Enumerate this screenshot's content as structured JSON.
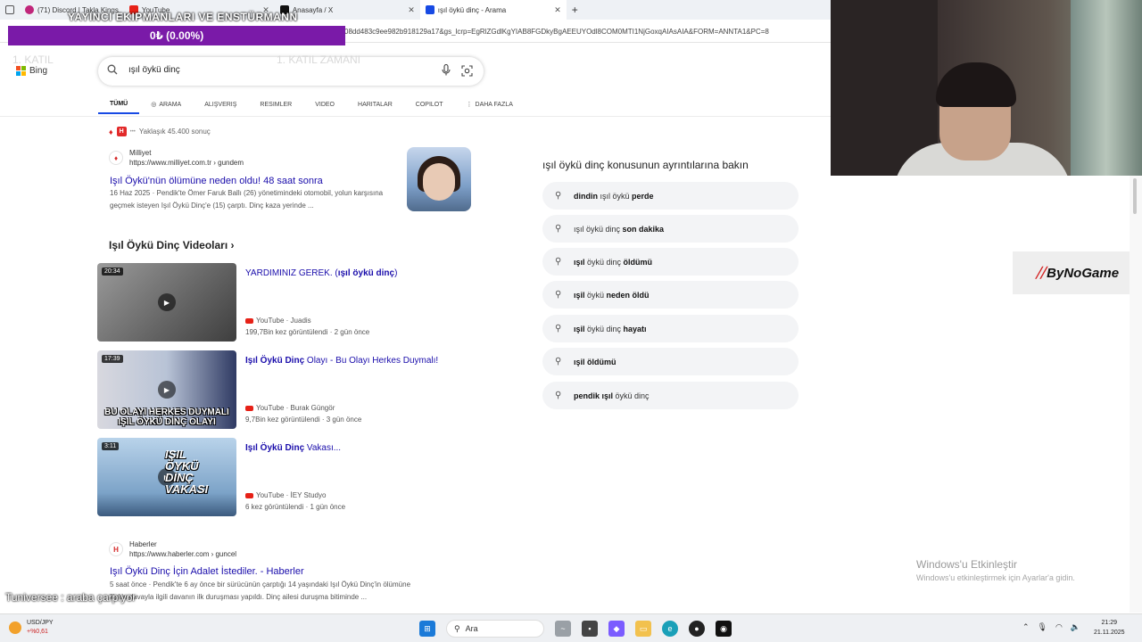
{
  "browser": {
    "tabs": [
      {
        "label": "(71) Discord | Takla Kings",
        "icon": "discord-icon",
        "color": "#5865f2"
      },
      {
        "label": "YouTube",
        "icon": "youtube-icon",
        "color": "#e62117"
      },
      {
        "label": "Anasayfa / X",
        "icon": "x-icon",
        "color": "#111111"
      },
      {
        "label": "ışıl öykü dinç - Arama",
        "icon": "bing-icon",
        "color": "#174ae4"
      }
    ],
    "new_tab": "+",
    "url": "08dd483c9ee982b918129a17&gs_lcrp=EgRlZGdlKgYIAB8FGDkyBgAEEUYOdl8COM0MTI1NjGoxqAIAsAIA&FORM=ANNTA1&PC=8"
  },
  "overlay": {
    "title": "YAYINCI EKIPMANLARI VE ENSTÜRMANN",
    "donation": "0₺ (0.00%)",
    "faint_left": "1. KATIL",
    "faint_mid": "1. KATIL ZAMANI",
    "sponsor": "ByNoGame",
    "ticker": "Tuniversee : araba çarpıyor",
    "activate_title": "Windows'u Etkinleştir",
    "activate_sub": "Windows'u etkinleştirmek için Ayarlar'a gidin."
  },
  "bing": {
    "logo": "Bing",
    "query": "ışıl öykü dinç",
    "tabs": [
      "TÜMÜ",
      "ARAMA",
      "ALIŞVERIŞ",
      "RESIMLER",
      "VIDEO",
      "HARITALAR",
      "COPILOT",
      "DAHA FAZLA"
    ]
  },
  "results": {
    "count": "Yaklaşık 45.400 sonuç",
    "first": {
      "site": "Milliyet",
      "url": "https://www.milliyet.com.tr › gundem",
      "title": "Işıl Öykü'nün ölümüne neden oldu! 48 saat sonra",
      "snippet": "16 Haz 2025 · Pendik'te Ömer Faruk Ballı (26) yönetimindeki otomobil, yolun karşısına geçmek isteyen Işıl Öykü Dinç'e (15) çarptı. Dinç kaza yerinde ..."
    },
    "videos_heading": "Işıl Öykü Dinç Videoları",
    "videos": [
      {
        "duration": "20:34",
        "title_pre": "YARDIMINIZ GEREK. (",
        "title_bold": "ışıl öykü dinç",
        "title_post": ")",
        "channel": "YouTube · Juadis",
        "meta": "199,7Bin kez görüntülendi · 2 gün önce"
      },
      {
        "duration": "17:39",
        "title_pre": "",
        "title_bold": "Işıl Öykü Dinç",
        "title_post": " Olayı - Bu Olayı Herkes Duymalı!",
        "channel": "YouTube · Burak Güngör",
        "meta": "9,7Bin kez görüntülendi · 3 gün önce",
        "caption": "BU OLAYI HERKES DUYMALI IŞIL ÖYKÜ DİNÇ OLAYI"
      },
      {
        "duration": "3:11",
        "title_pre": "",
        "title_bold": "Işıl Öykü Dinç",
        "title_post": " Vakası...",
        "channel": "YouTube · İEY Studyo",
        "meta": "6 kez görüntülendi · 1 gün önce",
        "caption": "IŞIL ÖYKÜ DİNÇ VAKASI"
      }
    ],
    "second": {
      "site": "Haberler",
      "url": "https://www.haberler.com › guncel",
      "title": "Işıl Öykü Dinç İçin Adalet İstediler. - Haberler",
      "snippet_line1": "5 saat önce · Pendik'te 6 ay önce bir sürücünün çarptığı 14 yaşındaki Işıl Öykü Dinç'in ölümüne",
      "snippet_line2": "ilişkin davayla ilgili davanın ilk duruşması yapıldı. Dinç ailesi duruşma bitiminde ..."
    }
  },
  "related": {
    "heading": "ışıl öykü dinç konusunun ayrıntılarına bakın",
    "items": [
      {
        "bold": "dindin",
        "normal": " ışıl öykü ",
        "bold2": "perde"
      },
      {
        "bold": "",
        "normal": "ışıl öykü dinç ",
        "bold2": "son dakika"
      },
      {
        "bold": "ışıl",
        "normal": " öykü dinç ",
        "bold2": "öldümü"
      },
      {
        "bold": "ışil",
        "normal": " öykü ",
        "bold2": "neden öldü"
      },
      {
        "bold": "ışil",
        "normal": " öykü dinç ",
        "bold2": "hayatı"
      },
      {
        "bold": "ışil",
        "normal": " ",
        "bold2": "öldümü"
      },
      {
        "bold": "pendik ışıl",
        "normal": " öykü dinç",
        "bold2": ""
      }
    ]
  },
  "taskbar": {
    "weather_label": "USD/JPY",
    "weather_value": "+%0,61",
    "search_placeholder": "Ara",
    "time": "21:29",
    "date": "21.11.2025"
  }
}
